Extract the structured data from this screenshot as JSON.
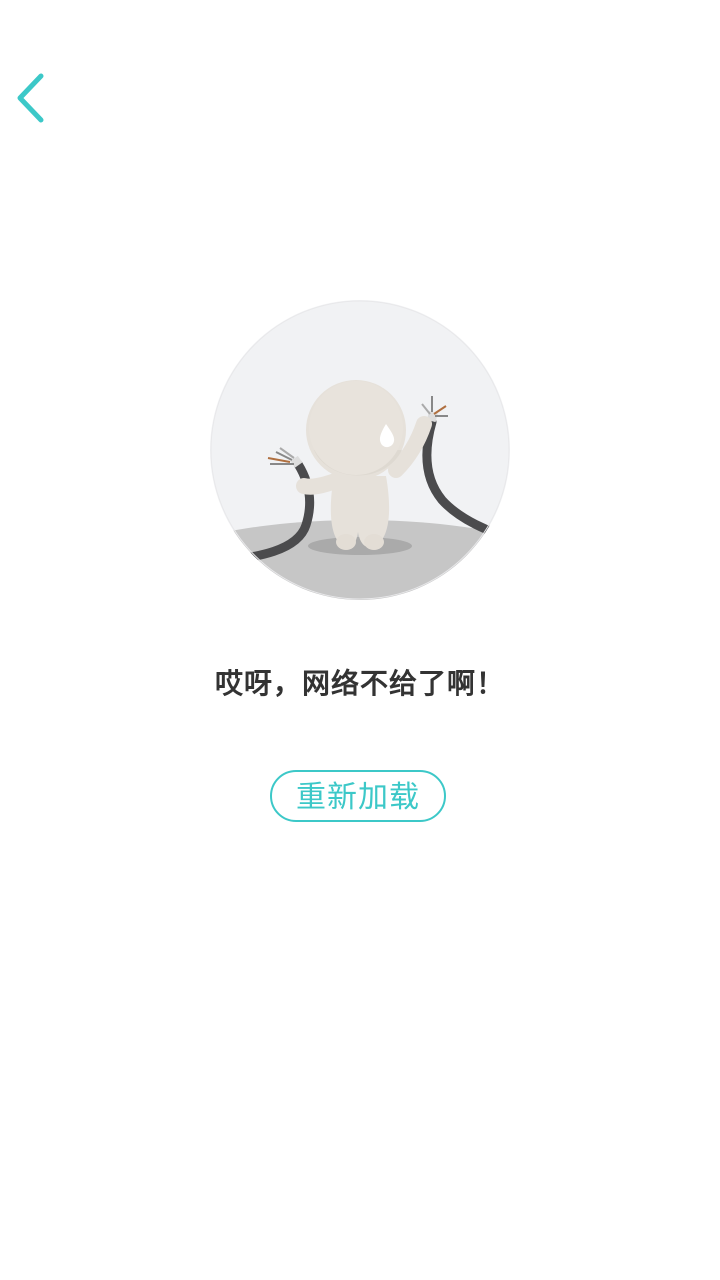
{
  "header": {
    "back_icon": "chevron-left-icon",
    "accent_color": "#3cc8c8"
  },
  "error_state": {
    "illustration": "broken-cable-character-illustration",
    "message": "哎呀，网络不给了啊！",
    "reload_label": "重新加载"
  }
}
